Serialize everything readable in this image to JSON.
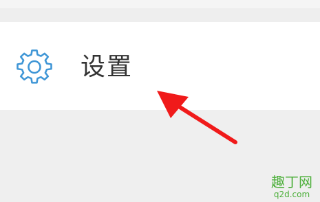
{
  "settings": {
    "label": "设置",
    "icon": "gear-icon",
    "icon_color": "#3f96d6"
  },
  "annotation": {
    "color": "#f01a1a"
  },
  "watermark": {
    "logo": "趣丁网",
    "domain": "q2d.com"
  }
}
